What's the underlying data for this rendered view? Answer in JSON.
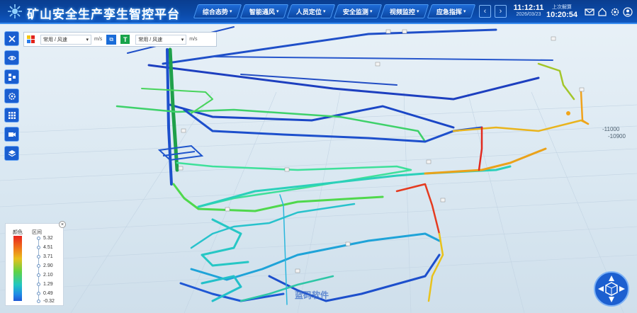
{
  "header": {
    "title": "矿山安全生产孪生智控平台",
    "nav": [
      "综合态势",
      "智能通风",
      "人员定位",
      "安全监测",
      "视频监控",
      "应急指挥"
    ],
    "current_time": "11:12:11",
    "current_date": "2026/03/23",
    "last_label": "上次解算",
    "last_time": "10:20:54"
  },
  "controls": {
    "left_select": "常用 / 风速",
    "left_unit": "m/s",
    "right_select": "常用 / 风速",
    "right_unit": "m/s",
    "t_label": "T"
  },
  "legend": {
    "color_header": "颜色",
    "range_header": "区间",
    "values": [
      "5.32",
      "4.51",
      "3.71",
      "2.90",
      "2.10",
      "1.29",
      "0.49",
      "-0.32"
    ]
  },
  "scene": {
    "axis_labels": [
      "-11000",
      "-10900"
    ],
    "watermark": "蓝码软件"
  },
  "colors": {
    "header_bg": "#0b4aa8",
    "accent": "#1a6cd8",
    "pipe_green": "#3ed16a",
    "pipe_cyan": "#25c8c4",
    "pipe_blue": "#1f57d4",
    "pipe_red": "#e22a1f",
    "pipe_orange": "#f0a21b"
  },
  "icons": [
    "logo-icon",
    "close-icon",
    "eye-icon",
    "layers-icon",
    "settings-icon",
    "grid-icon",
    "camera-icon",
    "stack-icon",
    "mail-icon",
    "home-icon",
    "gear-icon",
    "user-icon",
    "compass-icon"
  ]
}
